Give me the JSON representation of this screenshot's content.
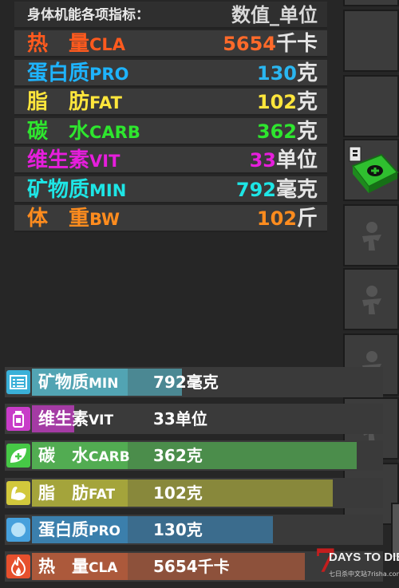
{
  "stats": {
    "header_label": "身体机能各项指标：",
    "header_value": "数值_单位",
    "rows": [
      {
        "name": "热　量",
        "abbr": "CLA",
        "value": "5654",
        "unit": "千卡",
        "color": "#ff5a1e",
        "value_color": "#ff6a2a"
      },
      {
        "name": "蛋白质",
        "abbr": "PRO",
        "value": "130",
        "unit": "克",
        "color": "#1eb4ff",
        "value_color": "#2ab6f0"
      },
      {
        "name": "脂　肪",
        "abbr": "FAT",
        "value": "102",
        "unit": "克",
        "color": "#ffe63c",
        "value_color": "#ffe63c"
      },
      {
        "name": "碳　水",
        "abbr": "CARB",
        "value": "362",
        "unit": "克",
        "color": "#2ee62e",
        "value_color": "#2ee62e"
      },
      {
        "name": "维生素",
        "abbr": "VIT",
        "value": "33",
        "unit": "单位",
        "color": "#e61edc",
        "value_color": "#e61edc"
      },
      {
        "name": "矿物质",
        "abbr": "MIN",
        "value": "792",
        "unit": "毫克",
        "color": "#1ee6e6",
        "value_color": "#1ee6e6"
      },
      {
        "name": "体　重",
        "abbr": "BW",
        "value": "102",
        "unit": "斤",
        "color": "#ff8c1e",
        "value_color": "#ff8c1e"
      }
    ]
  },
  "bars": [
    {
      "name": "矿物质",
      "abbr": "MIN",
      "value": "792毫克",
      "icon": "list-icon",
      "icon_bg": "#3ab0d8",
      "fill": "#5ac8dc",
      "level": 0.43
    },
    {
      "name": "维生素",
      "abbr": "VIT",
      "value": "33单位",
      "icon": "bottle-icon",
      "icon_bg": "#c83cc8",
      "fill": "#c83cc8",
      "level": 0.12
    },
    {
      "name": "碳　水",
      "abbr": "CARB",
      "value": "362克",
      "icon": "leaf-plus-icon",
      "icon_bg": "#46c846",
      "fill": "#5ad25a",
      "level": 0.93
    },
    {
      "name": "脂　肪",
      "abbr": "FAT",
      "value": "102克",
      "icon": "muscle-arm-icon",
      "icon_bg": "#d2c83c",
      "fill": "#c8c83c",
      "level": 0.86
    },
    {
      "name": "蛋白质",
      "abbr": "PRO",
      "value": "130克",
      "icon": "circle-icon",
      "icon_bg": "#46a0dc",
      "fill": "#3c96d2",
      "level": 0.69
    },
    {
      "name": "热　量",
      "abbr": "CLA",
      "value": "5654千卡",
      "icon": "flame-icon",
      "icon_bg": "#e6502d",
      "fill": "#d2643c",
      "level": 0.78
    }
  ],
  "watermark": {
    "logo_digit": "7",
    "title": "DAYS TO DIE",
    "subtitle": "七日杀中文站7risha.com"
  }
}
